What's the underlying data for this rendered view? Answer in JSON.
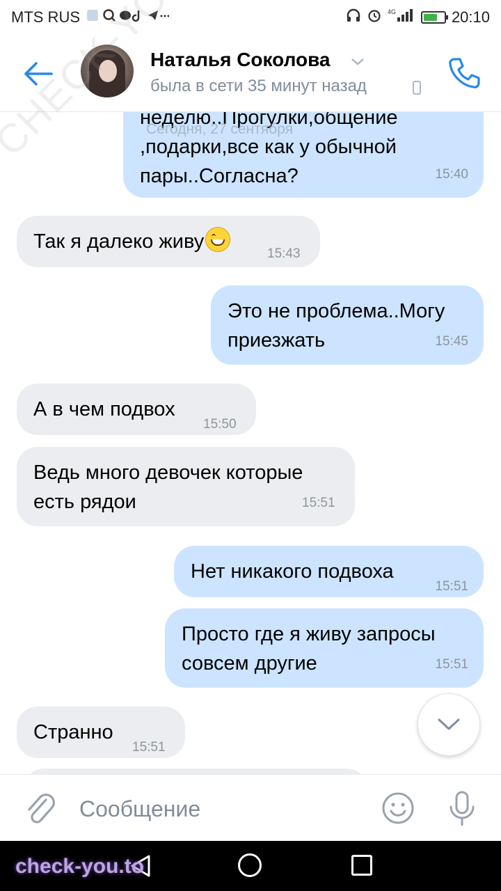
{
  "status_bar": {
    "carrier": "MTS RUS",
    "time": "20:10",
    "network": "4G"
  },
  "header": {
    "contact_name": "Наталья Соколова",
    "last_seen": "была в сети 35 минут назад"
  },
  "chat": {
    "date_separator": "Сегодня, 27 сентября",
    "messages": [
      {
        "direction": "out",
        "text_lines": [
          "неделю..Прогулки,общение",
          ",подарки,все как у обычной",
          "пары..Согласна?"
        ],
        "time": "15:40"
      },
      {
        "direction": "in",
        "text": "Так я далеко живу",
        "emoji": "grinning-face",
        "time": "15:43"
      },
      {
        "direction": "out",
        "text_lines": [
          "Это не проблема..Могу",
          "приезжать"
        ],
        "time": "15:45"
      },
      {
        "direction": "in",
        "text": "А в чем подвох",
        "time": "15:50"
      },
      {
        "direction": "in",
        "text_lines": [
          "Ведь много девочек которые",
          "есть рядои"
        ],
        "time": "15:51"
      },
      {
        "direction": "out",
        "text": "Нет никакого подвоха",
        "time": "15:51"
      },
      {
        "direction": "out",
        "text_lines": [
          "Просто где я живу запросы",
          "совсем другие"
        ],
        "time": "15:51"
      },
      {
        "direction": "in",
        "text": "Странно",
        "time": "15:51"
      }
    ]
  },
  "composer": {
    "placeholder": "Сообщение"
  },
  "watermarks": {
    "bottom": "check-you.to",
    "diagonal": "CHECK-YOU.ME"
  },
  "colors": {
    "accent": "#2688eb",
    "bubble_in": "#ebedf0",
    "bubble_out": "#cce4ff"
  }
}
